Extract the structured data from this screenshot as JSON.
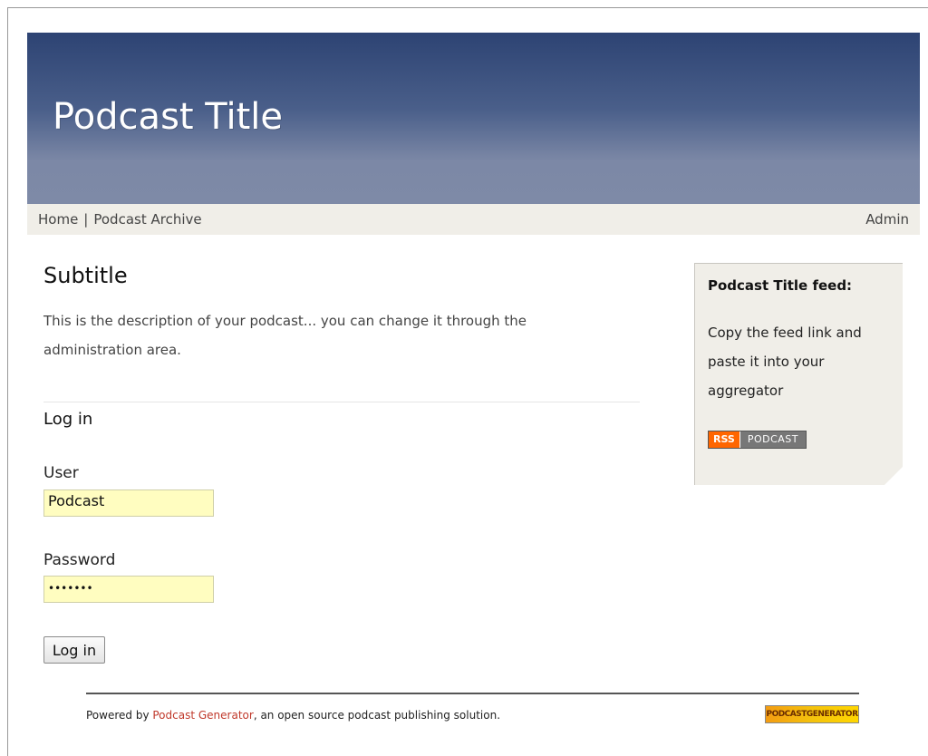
{
  "header": {
    "title": "Podcast Title"
  },
  "nav": {
    "home": "Home",
    "separator": "|",
    "archive": "Podcast Archive",
    "admin": "Admin"
  },
  "main": {
    "subtitle": "Subtitle",
    "description": "This is the description of your podcast... you can change it through the administration area.",
    "login_heading": "Log in",
    "user_label": "User",
    "user_value": "Podcast",
    "password_label": "Password",
    "password_value": "•••••••",
    "login_button": "Log in"
  },
  "sidebar": {
    "feed_title": "Podcast Title feed:",
    "feed_desc": "Copy the feed link and paste it into your aggregator",
    "rss_badge_rss": "RSS",
    "rss_badge_podcast": "PODCAST"
  },
  "footer": {
    "prefix": "Powered by ",
    "link": "Podcast Generator",
    "suffix": ", an open source podcast publishing solution.",
    "badge": "PODCASTGENERATOR"
  }
}
